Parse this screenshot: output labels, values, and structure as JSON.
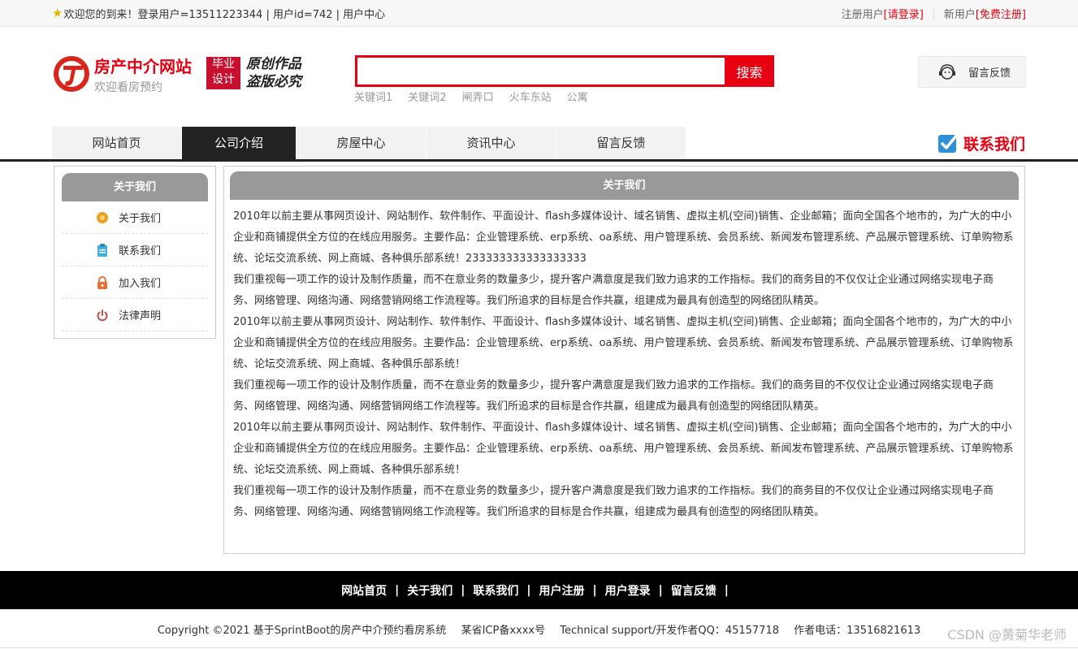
{
  "topbar": {
    "welcome": "欢迎您的到来！登录用户=13511223344 | 用户id=742 | 用户中心",
    "register_label": "注册用户",
    "login_link": "[请登录]",
    "new_user_label": "新用户",
    "free_register_link": "[免费注册]"
  },
  "header": {
    "title": "房产中介网站",
    "subtitle": "欢迎看房预约",
    "badge_line1": "毕业",
    "badge_line2": "设计",
    "slogan_line1": "原创作品",
    "slogan_line2": "盗版必究"
  },
  "search": {
    "value": "",
    "button_label": "搜索",
    "keywords": [
      "关键词1",
      "关键词2",
      "闸弄口",
      "火车东站",
      "公寓"
    ]
  },
  "feedback_button": {
    "label": "留言反馈"
  },
  "nav": {
    "items": [
      "网站首页",
      "公司介绍",
      "房屋中心",
      "资讯中心",
      "留言反馈"
    ],
    "active_index": 1
  },
  "contact_label": "联系我们",
  "sidebar": {
    "title": "关于我们",
    "items": [
      {
        "label": "关于我们",
        "icon": "circle-icon",
        "color": "#f0a020"
      },
      {
        "label": "联系我们",
        "icon": "clipboard-icon",
        "color": "#3fb0d8"
      },
      {
        "label": "加入我们",
        "icon": "lock-icon",
        "color": "#e5733a"
      },
      {
        "label": "法律声明",
        "icon": "power-icon",
        "color": "#c0504d"
      }
    ]
  },
  "main": {
    "title": "关于我们",
    "paragraphs": [
      "2010年以前主要从事网页设计、网站制作、软件制作、平面设计、flash多媒体设计、域名销售、虚拟主机(空间)销售、企业邮箱；面向全国各个地市的，为广大的中小企业和商铺提供全方位的在线应用服务。主要作品：企业管理系统、erp系统、oa系统、用户管理系统、会员系统、新闻发布管理系统、产品展示管理系统、订单购物系统、论坛交流系统、网上商城、各种俱乐部系统！233333333333333333",
      "我们重视每一项工作的设计及制作质量，而不在意业务的数量多少，提升客户满意度是我们致力追求的工作指标。我们的商务目的不仅仅让企业通过网络实现电子商务、网络管理、网络沟通、网络营销网络工作流程等。我们所追求的目标是合作共赢，组建成为最具有创造型的网络团队精英。",
      "2010年以前主要从事网页设计、网站制作、软件制作、平面设计、flash多媒体设计、域名销售、虚拟主机(空间)销售、企业邮箱；面向全国各个地市的，为广大的中小企业和商铺提供全方位的在线应用服务。主要作品：企业管理系统、erp系统、oa系统、用户管理系统、会员系统、新闻发布管理系统、产品展示管理系统、订单购物系统、论坛交流系统、网上商城、各种俱乐部系统！",
      "我们重视每一项工作的设计及制作质量，而不在意业务的数量多少，提升客户满意度是我们致力追求的工作指标。我们的商务目的不仅仅让企业通过网络实现电子商务、网络管理、网络沟通、网络营销网络工作流程等。我们所追求的目标是合作共赢，组建成为最具有创造型的网络团队精英。",
      "2010年以前主要从事网页设计、网站制作、软件制作、平面设计、flash多媒体设计、域名销售、虚拟主机(空间)销售、企业邮箱；面向全国各个地市的，为广大的中小企业和商铺提供全方位的在线应用服务。主要作品：企业管理系统、erp系统、oa系统、用户管理系统、会员系统、新闻发布管理系统、产品展示管理系统、订单购物系统、论坛交流系统、网上商城、各种俱乐部系统！",
      "我们重视每一项工作的设计及制作质量，而不在意业务的数量多少，提升客户满意度是我们致力追求的工作指标。我们的商务目的不仅仅让企业通过网络实现电子商务、网络管理、网络沟通、网络营销网络工作流程等。我们所追求的目标是合作共赢，组建成为最具有创造型的网络团队精英。"
    ]
  },
  "footer": {
    "links": [
      "网站首页",
      "关于我们",
      "联系我们",
      "用户注册",
      "用户登录",
      "留言反馈"
    ],
    "copyright": "Copyright ©2021 基于SprintBoot的房产中介预约看房系统",
    "icp": "某省ICP备xxxx号",
    "support": "Technical support/开发作者QQ：45157718",
    "phone": "作者电话：13516821613"
  },
  "watermark": "CSDN @黄菊华老师",
  "colors": {
    "accent_red": "#e60012",
    "nav_active": "#222222",
    "panel_head": "#999999"
  }
}
